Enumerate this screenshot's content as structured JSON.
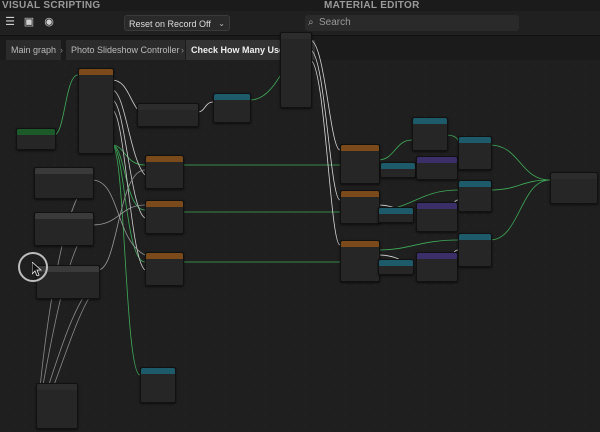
{
  "panels": {
    "left_title": "VISUAL SCRIPTING",
    "right_title": "MATERIAL EDITOR"
  },
  "toolbar": {
    "reset_dropdown": "Reset on Record Off",
    "search_placeholder": "Search"
  },
  "breadcrumb": [
    "Main graph",
    "Photo Slideshow Controller",
    "Check How Many User Me..."
  ],
  "colors": {
    "background": "#1f1f1f",
    "wire_green": "#3fae5a",
    "wire_white": "#d8d8d8",
    "wire_gray": "#8a8a8a",
    "header_orange": "#7a4a1a",
    "header_teal": "#1d5a6a",
    "header_purple": "#3b2f6a"
  },
  "icons": {
    "menu": "hamburger-icon",
    "preview": "preview-window-icon",
    "record": "record-icon",
    "search": "search-icon"
  }
}
